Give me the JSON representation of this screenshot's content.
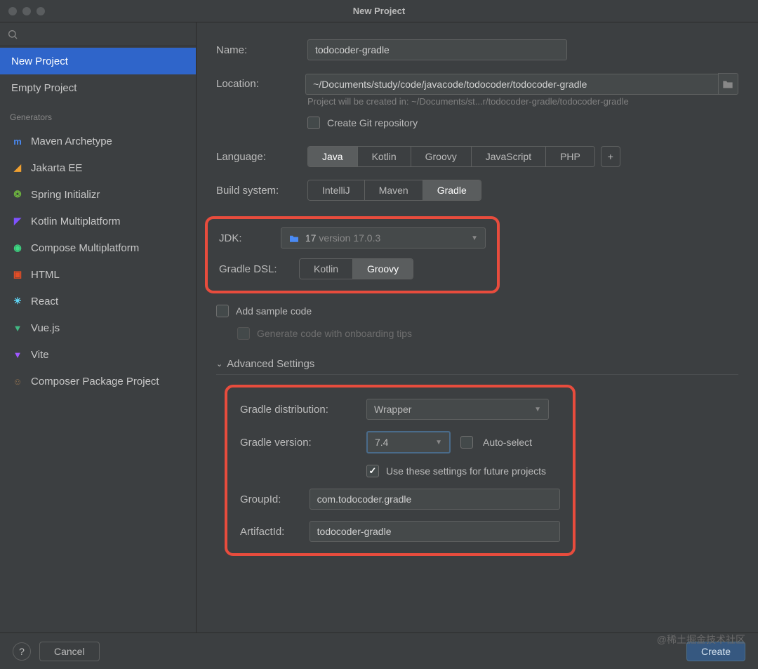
{
  "window": {
    "title": "New Project"
  },
  "sidebar": {
    "heading": "Generators",
    "project_types": [
      {
        "label": "New Project",
        "selected": true
      },
      {
        "label": "Empty Project",
        "selected": false
      }
    ],
    "generators": [
      {
        "label": "Maven Archetype",
        "icon_color": "#4a8af4",
        "glyph": "m"
      },
      {
        "label": "Jakarta EE",
        "icon_color": "#f0a030",
        "glyph": "◢"
      },
      {
        "label": "Spring Initializr",
        "icon_color": "#6db33f",
        "glyph": "❂"
      },
      {
        "label": "Kotlin Multiplatform",
        "icon_color": "#7f52ff",
        "glyph": "◤"
      },
      {
        "label": "Compose Multiplatform",
        "icon_color": "#3ddc84",
        "glyph": "◉"
      },
      {
        "label": "HTML",
        "icon_color": "#e44d26",
        "glyph": "▣"
      },
      {
        "label": "React",
        "icon_color": "#61dafb",
        "glyph": "✳"
      },
      {
        "label": "Vue.js",
        "icon_color": "#42b883",
        "glyph": "▼"
      },
      {
        "label": "Vite",
        "icon_color": "#a058ff",
        "glyph": "▼"
      },
      {
        "label": "Composer Package Project",
        "icon_color": "#8e6f4e",
        "glyph": "☺"
      }
    ]
  },
  "form": {
    "name_label": "Name:",
    "name_value": "todocoder-gradle",
    "location_label": "Location:",
    "location_value": "~/Documents/study/code/javacode/todocoder/todocoder-gradle",
    "location_hint": "Project will be created in: ~/Documents/st...r/todocoder-gradle/todocoder-gradle",
    "git_label": "Create Git repository",
    "git_checked": false,
    "language_label": "Language:",
    "languages": [
      "Java",
      "Kotlin",
      "Groovy",
      "JavaScript",
      "PHP"
    ],
    "language_selected": "Java",
    "build_label": "Build system:",
    "build_systems": [
      "IntelliJ",
      "Maven",
      "Gradle"
    ],
    "build_selected": "Gradle",
    "jdk_label": "JDK:",
    "jdk_value": "17",
    "jdk_version_suffix": "version 17.0.3",
    "dsl_label": "Gradle DSL:",
    "dsls": [
      "Kotlin",
      "Groovy"
    ],
    "dsl_selected": "Groovy",
    "sample_label": "Add sample code",
    "sample_checked": false,
    "onboarding_label": "Generate code with onboarding tips",
    "onboarding_checked": false
  },
  "advanced": {
    "header": "Advanced Settings",
    "dist_label": "Gradle distribution:",
    "dist_value": "Wrapper",
    "version_label": "Gradle version:",
    "version_value": "7.4",
    "autoselect_label": "Auto-select",
    "autoselect_checked": false,
    "future_label": "Use these settings for future projects",
    "future_checked": true,
    "group_label": "GroupId:",
    "group_value": "com.todocoder.gradle",
    "artifact_label": "ArtifactId:",
    "artifact_value": "todocoder-gradle"
  },
  "footer": {
    "help": "?",
    "cancel": "Cancel",
    "create": "Create"
  },
  "watermark": "@稀土掘金技术社区"
}
